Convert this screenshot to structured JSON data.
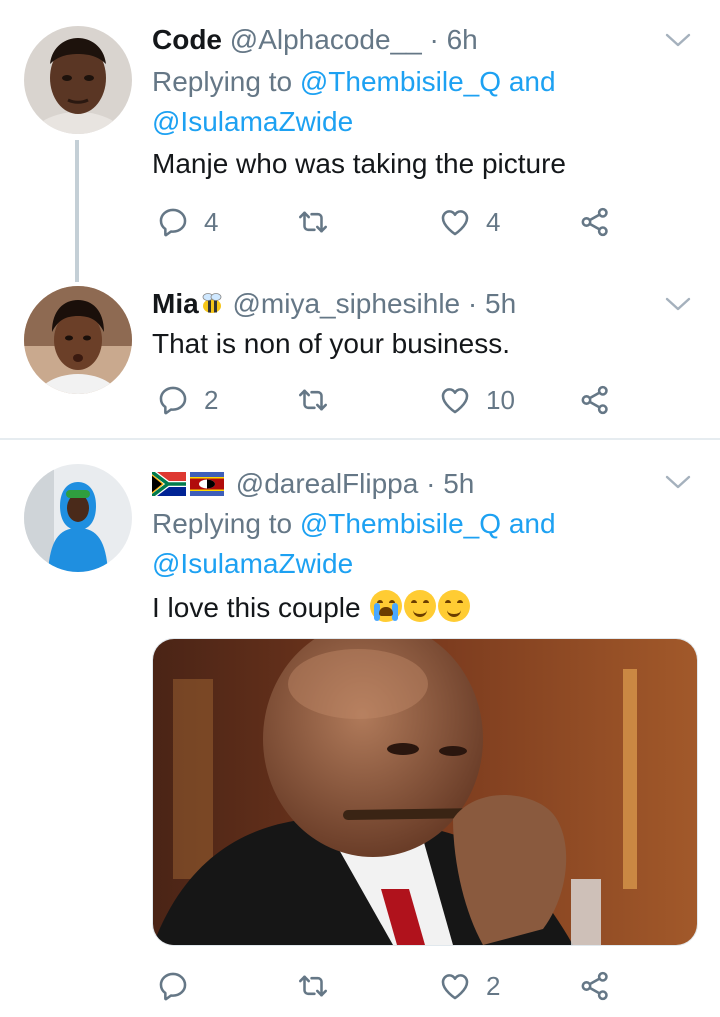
{
  "tweets": [
    {
      "name": "Code",
      "handle": "@Alphacode__",
      "time": "· 6h",
      "replying_prefix": "Replying to",
      "mention1": "@Thembisile_Q",
      "and_word": "and",
      "mention2": "@IsulamaZwide",
      "text": "Manje who was taking the picture",
      "reply_count": "4",
      "retweet_count": "",
      "like_count": "4"
    },
    {
      "name": "Mia",
      "handle": "@miya_siphesihle",
      "time": "· 5h",
      "text": "That is non of your business.",
      "reply_count": "2",
      "retweet_count": "",
      "like_count": "10"
    },
    {
      "name": "",
      "handle": "@darealFlippa",
      "time": "· 5h",
      "replying_prefix": "Replying to",
      "mention1": "@Thembisile_Q",
      "and_word": "and",
      "mention2": "@IsulamaZwide",
      "text": "I love this couple",
      "reply_count": "",
      "retweet_count": "",
      "like_count": "2"
    }
  ],
  "icons": {
    "reply": "reply-icon",
    "retweet": "retweet-icon",
    "like": "like-icon",
    "share": "share-icon",
    "caret": "chevron-down-icon"
  },
  "colors": {
    "link": "#1da1f2",
    "muted": "#657786",
    "text": "#14171a"
  }
}
